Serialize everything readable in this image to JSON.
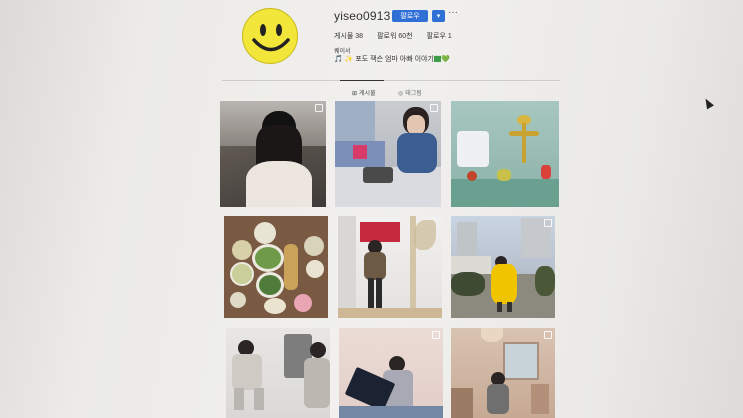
{
  "profile": {
    "username": "yiseo0913",
    "follow_label": "팔로우",
    "dropdown_label": "▾",
    "more_label": "···",
    "stats": {
      "posts": "게시물 38",
      "followers": "팔로워 60천",
      "following": "팔로우 1"
    },
    "name": "퀘이서",
    "bio": "🎵 ✨ 포도 잭슨 엄마 아빠 이야기",
    "bio_hearts": "▇💚"
  },
  "tabs": {
    "posts": "게시물",
    "tagged": "태그됨"
  },
  "posts": [
    {
      "row": 0,
      "col": 0,
      "description": "girl black beanie mask"
    },
    {
      "row": 0,
      "col": 1,
      "description": "girl craft table"
    },
    {
      "row": 0,
      "col": 2,
      "description": "toy figures candlestick"
    },
    {
      "row": 1,
      "col": 0,
      "description": "food table"
    },
    {
      "row": 1,
      "col": 1,
      "description": "girl by wall"
    },
    {
      "row": 1,
      "col": 2,
      "description": "yellow puffer jacket"
    },
    {
      "row": 2,
      "col": 0,
      "description": "girls posing"
    },
    {
      "row": 2,
      "col": 1,
      "description": "girl with laptop"
    },
    {
      "row": 2,
      "col": 2,
      "description": "girl in room"
    }
  ],
  "colors": {
    "follow_button": "#2f6fd6",
    "avatar": "#f2e63a"
  }
}
